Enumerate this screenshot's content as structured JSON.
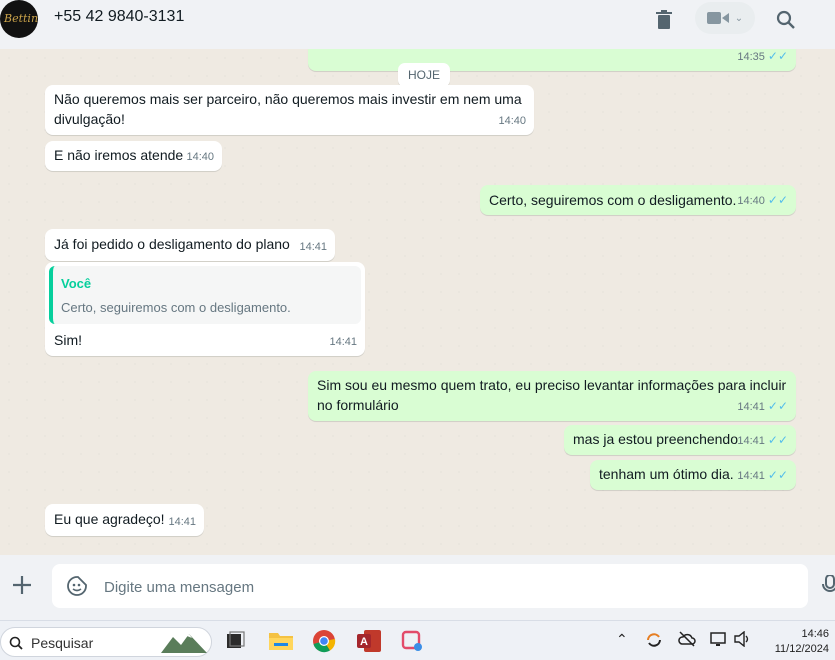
{
  "header": {
    "avatar_text": "Bettine",
    "contact": "+55 42 9840-3131",
    "icons": [
      "trash-icon",
      "video-icon",
      "chevron-down-icon",
      "search-icon"
    ]
  },
  "chat": {
    "top_partial_time": "14:35",
    "day_label": "HOJE",
    "messages": [
      {
        "dir": "in",
        "lines": [
          "Não queremos mais ser parceiro, não queremos mais investir em nem uma",
          "divulgação!"
        ],
        "time": "14:40"
      },
      {
        "dir": "in",
        "text": "E não iremos atende",
        "time": "14:40"
      },
      {
        "dir": "out",
        "text": "Certo, seguiremos com o desligamento.",
        "time": "14:40"
      },
      {
        "dir": "in",
        "text": "Já foi pedido o desligamento do plano",
        "time": "14:41"
      },
      {
        "dir": "in",
        "quote_author": "Você",
        "quote_text": "Certo, seguiremos com o desligamento.",
        "text": "Sim!",
        "time": "14:41"
      },
      {
        "dir": "out",
        "lines": [
          "Sim sou eu mesmo quem trato, eu preciso levantar informações para incluir",
          "no formulário"
        ],
        "time": "14:41"
      },
      {
        "dir": "out",
        "text": "mas ja estou preenchendo",
        "time": "14:41"
      },
      {
        "dir": "out",
        "text": "tenham um ótimo dia.",
        "time": "14:41"
      },
      {
        "dir": "in",
        "text": "Eu que agradeço!",
        "time": "14:41"
      }
    ]
  },
  "composer": {
    "placeholder": "Digite uma mensagem"
  },
  "taskbar": {
    "search_label": "Pesquisar",
    "time": "14:46",
    "date": "11/12/2024"
  },
  "colors": {
    "incoming": "#ffffff",
    "outgoing": "#d9fdd3",
    "read_ticks": "#53bdeb",
    "quote_accent": "#06cf9c"
  }
}
